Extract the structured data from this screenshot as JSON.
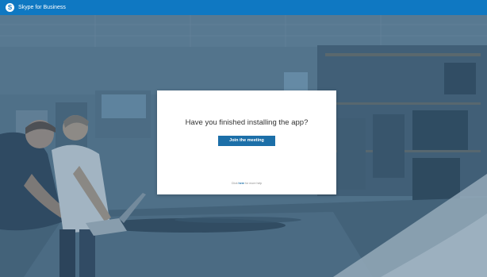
{
  "window": {
    "title": "Skype for Business",
    "logo_glyph": "S"
  },
  "dialog": {
    "heading": "Have you finished installing the app?",
    "join_button_label": "Join the meeting",
    "help_prefix": "Click",
    "help_link": "here",
    "help_suffix": "for more help"
  },
  "colors": {
    "titlebar": "#0f78c2",
    "button": "#1c6fa8",
    "dialog_bg": "#ffffff"
  },
  "icons": {
    "logo": "skype-logo-icon"
  }
}
